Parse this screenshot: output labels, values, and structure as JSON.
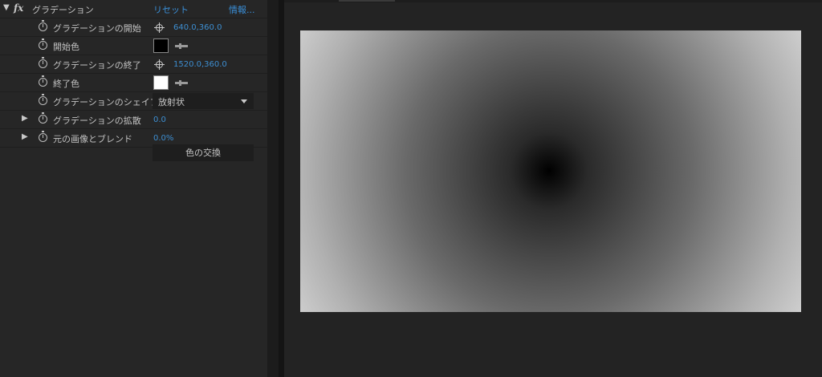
{
  "effect": {
    "name": "グラデーション",
    "reset_label": "リセット",
    "info_label": "情報..."
  },
  "properties": [
    {
      "label": "グラデーションの開始",
      "value": "640.0,360.0"
    },
    {
      "label": "開始色",
      "color": "#000000"
    },
    {
      "label": "グラデーションの終了",
      "value": "1520.0,360.0"
    },
    {
      "label": "終了色",
      "color": "#ffffff"
    },
    {
      "label": "グラデーションのシェイプ",
      "value": "放射状"
    },
    {
      "label": "グラデーションの拡散",
      "value": "0.0"
    },
    {
      "label": "元の画像とブレンド",
      "value": "0.0%"
    }
  ],
  "swap_button_label": "色の交換",
  "icons": {
    "expand": "triangle-down-icon",
    "collapsed": "triangle-right-icon",
    "stopwatch": "stopwatch-icon",
    "target": "crosshair-target-icon",
    "eyedropper": "eyedropper-icon",
    "dropdown": "chevron-down-icon"
  },
  "colors": {
    "link": "#3a8fd8",
    "panel": "#262626",
    "viewer": "#232323"
  }
}
